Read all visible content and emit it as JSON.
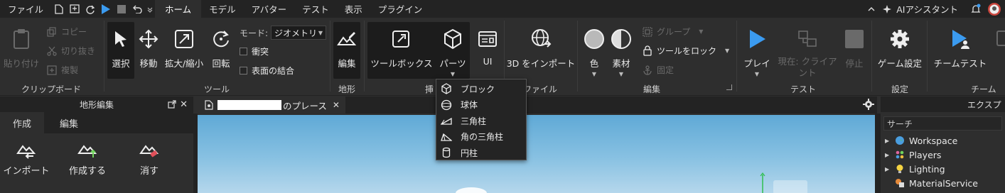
{
  "titlebar": {
    "file_menu": "ファイル",
    "tabs": [
      "ホーム",
      "モデル",
      "アバター",
      "テスト",
      "表示",
      "プラグイン"
    ],
    "ai_assistant": "AIアシスタント"
  },
  "ribbon": {
    "clipboard": {
      "paste": "貼り付け",
      "copy": "コピー",
      "cut": "切り抜き",
      "duplicate": "複製",
      "label": "クリップボード"
    },
    "tools": {
      "select": "選択",
      "move": "移動",
      "scale": "拡大/縮小",
      "rotate": "回転",
      "mode_label": "モード:",
      "mode_value": "ジオメトリ",
      "collisions": "衝突",
      "join_surfaces": "表面の結合",
      "label": "ツール"
    },
    "terrain": {
      "edit": "編集",
      "label": "地形"
    },
    "insert": {
      "toolbox": "ツールボックス",
      "parts": "パーツ",
      "ui": "UI",
      "label": "挿"
    },
    "file": {
      "import3d": "3D をインポート",
      "label": "ファイル"
    },
    "edit": {
      "color": "色",
      "material": "素材",
      "group": "グループ",
      "lock_tool": "ツールをロック",
      "anchor": "固定",
      "label": "編集"
    },
    "test": {
      "play": "プレイ",
      "current_client": "現在: クライアント",
      "stop": "停止",
      "label": "テスト"
    },
    "settings": {
      "game_settings": "ゲーム設定",
      "label": "設定"
    },
    "team": {
      "team_test": "チームテスト",
      "label": "チーム"
    }
  },
  "parts_menu": [
    "ブロック",
    "球体",
    "三角柱",
    "角の三角柱",
    "円柱"
  ],
  "terrain_panel": {
    "title": "地形編集",
    "tabs": [
      "作成",
      "編集"
    ],
    "buttons": [
      "インポート",
      "作成する",
      "消す"
    ]
  },
  "viewport": {
    "tab_suffix": "のプレース"
  },
  "explorer": {
    "title": "エクスプ",
    "search_placeholder": "サーチ",
    "items": [
      "Workspace",
      "Players",
      "Lighting",
      "MaterialService"
    ]
  },
  "colors": {
    "accent": "#3b9bf0",
    "background": "#2e2e2e",
    "dark": "#232323"
  }
}
